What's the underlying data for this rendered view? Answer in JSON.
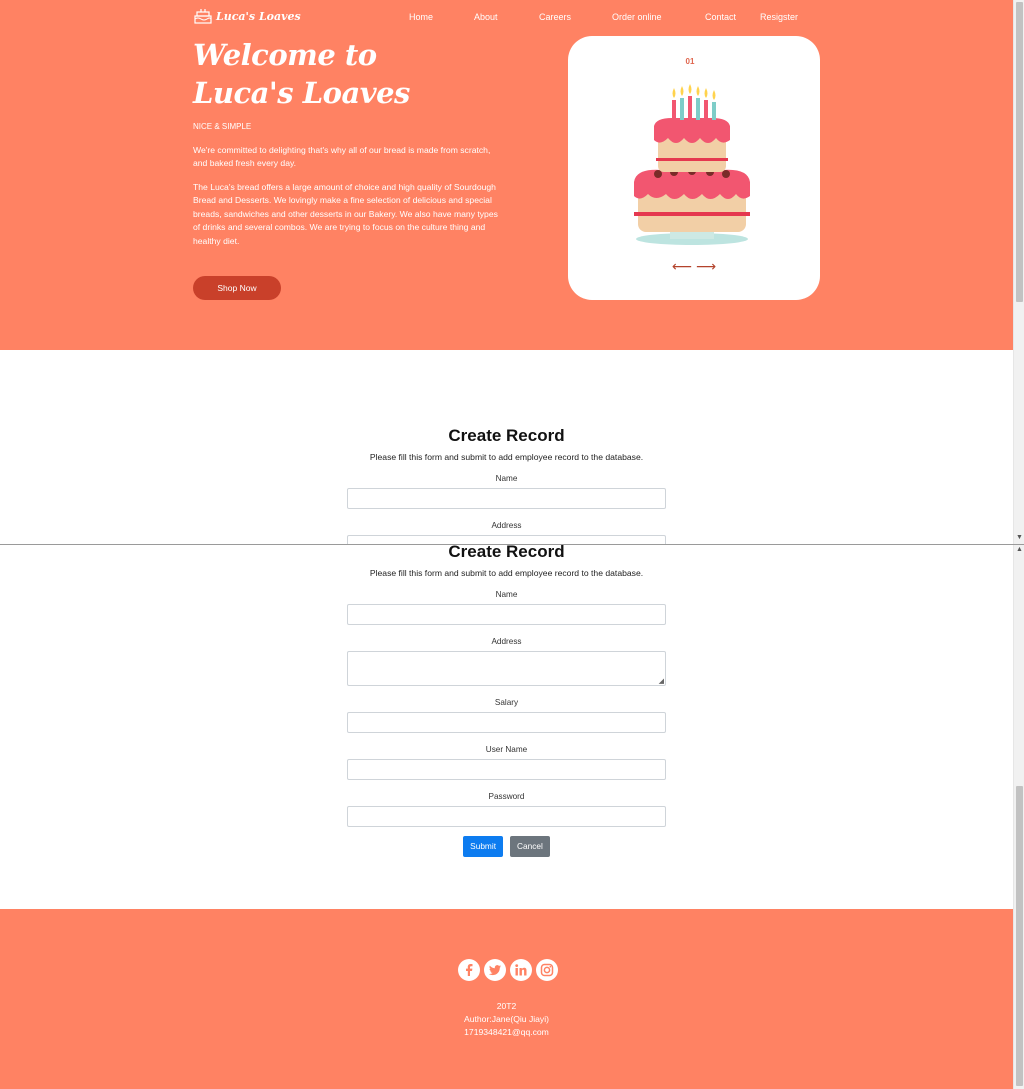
{
  "brand": {
    "name": "Luca's Loaves"
  },
  "nav": {
    "items": [
      "Home",
      "About",
      "Careers",
      "Order online",
      "Contact",
      "Resigster"
    ]
  },
  "hero": {
    "title_line1": "Welcome to",
    "title_line2": "Luca's Loaves",
    "tagline": "NICE & SIMPLE",
    "para1": "We're committed to delighting that's why all of our bread is made from scratch, and baked fresh every day.",
    "para2": "The Luca's bread offers a large amount of choice and high quality of Sourdough Bread and Desserts. We lovingly make a fine selection of delicious and special breads, sandwiches and other desserts in our Bakery. We also have many types of drinks and several combos. We are trying to focus on the culture thing and healthy diet.",
    "shop_button": "Shop Now",
    "slide_number": "01",
    "prev_arrow": "⟵",
    "next_arrow": "⟶"
  },
  "form": {
    "title": "Create Record",
    "subtitle": "Please fill this form and submit to add employee record to the database.",
    "labels": {
      "name": "Name",
      "address": "Address",
      "salary": "Salary",
      "username": "User Name",
      "password": "Password"
    },
    "submit": "Submit",
    "cancel": "Cancel"
  },
  "footer": {
    "line1": "20T2",
    "line2": "Author:Jane(Qiu Jiayi)",
    "line3": "1719348421@qq.com"
  },
  "colors": {
    "hero_bg": "#ff8263",
    "shop_button": "#c9402a",
    "submit": "#0d7cf0",
    "cancel": "#6c757d"
  },
  "icons": [
    "cake-logo-icon",
    "facebook-icon",
    "twitter-icon",
    "linkedin-icon",
    "instagram-icon"
  ]
}
